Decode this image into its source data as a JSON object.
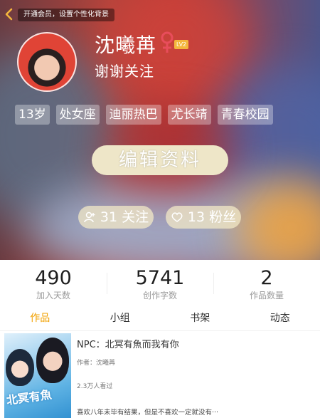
{
  "header": {
    "vip_tip": "开通会员，设置个性化背景",
    "name": "沈曦苒",
    "level": "LV2",
    "signature": "谢谢关注",
    "tags": [
      "13岁",
      "处女座",
      "迪丽热巴",
      "尤长靖",
      "青春校园"
    ],
    "edit_label": "编辑资料",
    "following_label": "31 关注",
    "fans_label": "13 粉丝"
  },
  "stats": [
    {
      "value": "490",
      "label": "加入天数"
    },
    {
      "value": "5741",
      "label": "创作字数"
    },
    {
      "value": "2",
      "label": "作品数量"
    }
  ],
  "tabs": [
    "作品",
    "小组",
    "书架",
    "动态"
  ],
  "work": {
    "title": "NPC：北冥有魚而我有你",
    "author": "作者：沈曦苒",
    "views": "2.3万人看过",
    "description": "喜欢八年未毕有结果，但是不喜欢一定就没有···",
    "cover_text": "北冥有魚"
  },
  "colors": {
    "accent": "#f2a100",
    "gender": "#e84d5b",
    "level_badge": "#f4b63d"
  }
}
